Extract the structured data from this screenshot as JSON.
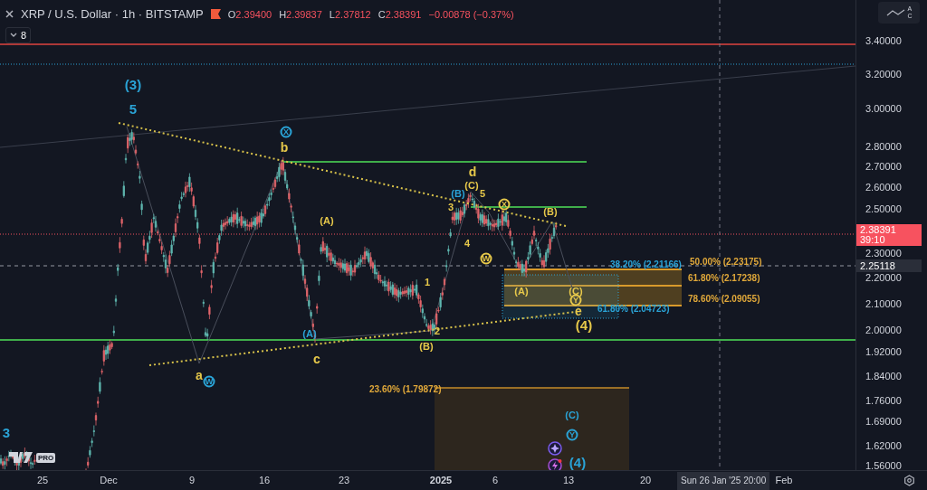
{
  "header": {
    "title": "XRP / U.S. Dollar · 1h · BITSTAMP",
    "ohlc": [
      {
        "key": "O",
        "value": "2.39400"
      },
      {
        "key": "H",
        "value": "2.39837"
      },
      {
        "key": "L",
        "value": "2.37812"
      },
      {
        "key": "C",
        "value": "2.38391"
      }
    ],
    "change": "−0.00878 (−0.37%)",
    "indicators_count": "8"
  },
  "wave_tool_letters": [
    "A",
    "C"
  ],
  "price_axis": {
    "ticks": [
      "3.40000",
      "3.20000",
      "3.00000",
      "2.80000",
      "2.70000",
      "2.60000",
      "2.50000",
      "2.30000",
      "2.20000",
      "2.10000",
      "2.00000",
      "1.92000",
      "1.84000",
      "1.76000",
      "1.69000",
      "1.62000",
      "1.56000"
    ],
    "last_price": "2.38391",
    "countdown": "39:10",
    "crosshair_price": "2.25118"
  },
  "time_axis": {
    "ticks": [
      {
        "label": "25",
        "major": false
      },
      {
        "label": "Dec",
        "major": false
      },
      {
        "label": "9",
        "major": false
      },
      {
        "label": "16",
        "major": false
      },
      {
        "label": "23",
        "major": false
      },
      {
        "label": "2025",
        "major": true
      },
      {
        "label": "6",
        "major": false
      },
      {
        "label": "13",
        "major": false
      },
      {
        "label": "20",
        "major": false
      },
      {
        "label": "Feb",
        "major": false
      }
    ],
    "crosshair_time": "Sun 26 Jan '25 20:00"
  },
  "wave_labels": [
    {
      "text": "(3)",
      "kind": "big",
      "color": "#2aa3d6"
    },
    {
      "text": "5",
      "kind": "big",
      "color": "#2aa3d6"
    },
    {
      "text": "X",
      "kind": "circled",
      "color": "#2aa3d6"
    },
    {
      "text": "b",
      "kind": "plain",
      "color": "#e6c84a"
    },
    {
      "text": "(A)",
      "kind": "small",
      "color": "#e6c84a"
    },
    {
      "text": "(A)",
      "kind": "small",
      "color": "#2aa3d6"
    },
    {
      "text": "c",
      "kind": "plain",
      "color": "#e6c84a"
    },
    {
      "text": "a",
      "kind": "plain",
      "color": "#e6c84a"
    },
    {
      "text": "W",
      "kind": "circled",
      "color": "#2aa3d6"
    },
    {
      "text": "d",
      "kind": "plain",
      "color": "#e6c84a"
    },
    {
      "text": "(B)",
      "kind": "small",
      "color": "#2aa3d6"
    },
    {
      "text": "(C)",
      "kind": "small",
      "color": "#e6c84a"
    },
    {
      "text": "5",
      "kind": "small",
      "color": "#e6c84a"
    },
    {
      "text": "3",
      "kind": "small",
      "color": "#e6c84a"
    },
    {
      "text": "X",
      "kind": "circled",
      "color": "#e6c84a"
    },
    {
      "text": "(B)",
      "kind": "small",
      "color": "#e6c84a"
    },
    {
      "text": "4",
      "kind": "small",
      "color": "#e6c84a"
    },
    {
      "text": "W",
      "kind": "circled",
      "color": "#e6c84a"
    },
    {
      "text": "1",
      "kind": "small",
      "color": "#e6c84a"
    },
    {
      "text": "2",
      "kind": "small",
      "color": "#e6c84a"
    },
    {
      "text": "(B)",
      "kind": "small",
      "color": "#e6c84a"
    },
    {
      "text": "(A)",
      "kind": "small",
      "color": "#e6c84a"
    },
    {
      "text": "(C)",
      "kind": "small",
      "color": "#e6c84a"
    },
    {
      "text": "Y",
      "kind": "circled",
      "color": "#e6c84a"
    },
    {
      "text": "e",
      "kind": "plain",
      "color": "#e6c84a"
    },
    {
      "text": "(4)",
      "kind": "big",
      "color": "#e6c84a"
    },
    {
      "text": "(C)",
      "kind": "small",
      "color": "#2aa3d6"
    },
    {
      "text": "Y",
      "kind": "circled",
      "color": "#2aa3d6"
    },
    {
      "text": "(4)",
      "kind": "big",
      "color": "#2aa3d6"
    },
    {
      "text": "3",
      "kind": "big",
      "color": "#2aa3d6"
    }
  ],
  "fib_labels": [
    {
      "text": "38.20% (2.21166)",
      "color": "#2aa3d6"
    },
    {
      "text": "50.00% (2.23175)",
      "color": "#e0a83a"
    },
    {
      "text": "61.80% (2.17238)",
      "color": "#e0a83a"
    },
    {
      "text": "78.60% (2.09055)",
      "color": "#e0a83a"
    },
    {
      "text": "61.80% (2.04723)",
      "color": "#2aa3d6"
    },
    {
      "text": "23.60% (1.79872)",
      "color": "#e0a83a"
    }
  ],
  "logo": {
    "badge": "PRO"
  }
}
